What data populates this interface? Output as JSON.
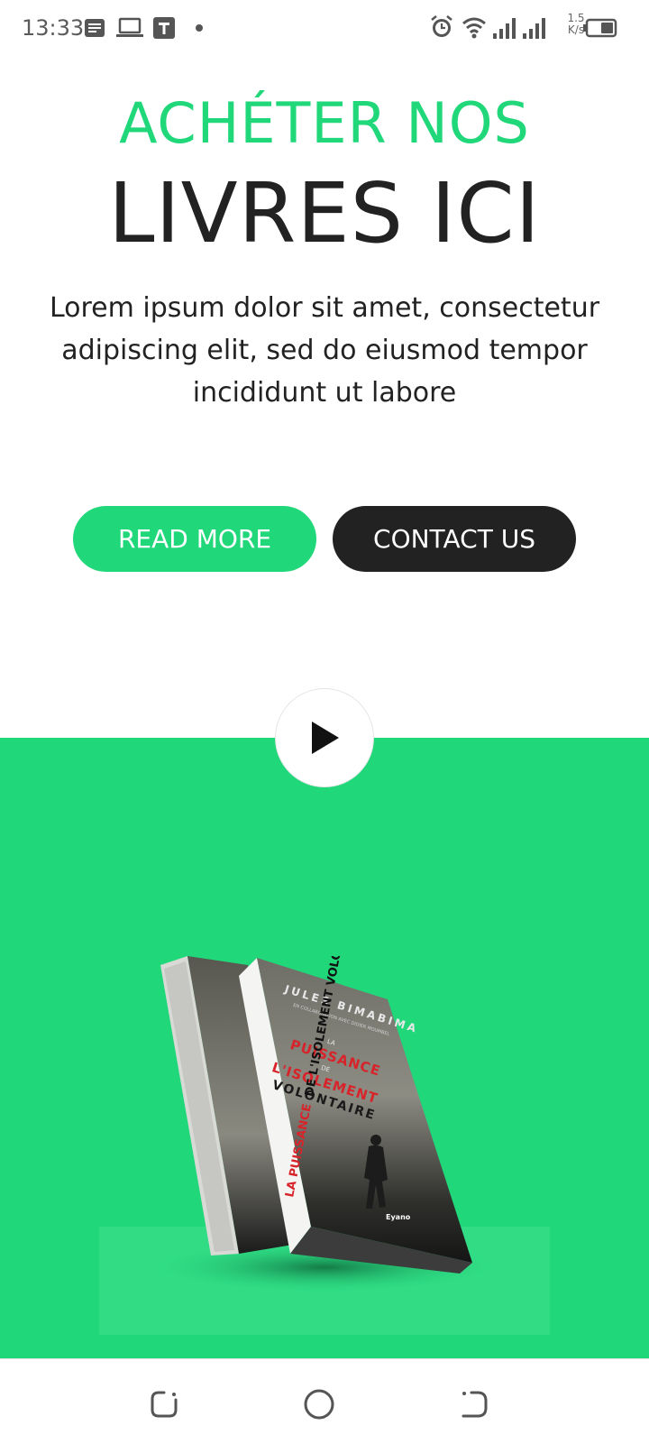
{
  "status_bar": {
    "time": "13:33",
    "speed_top": "1.5",
    "speed_bottom": "K/s",
    "left_icons": [
      "notes-icon",
      "laptop-icon",
      "t-app-icon",
      "dot-icon"
    ],
    "right_icons": [
      "alarm-icon",
      "wifi-icon",
      "signal-icon",
      "signal-icon",
      "battery-icon"
    ]
  },
  "hero": {
    "title_line1": "ACHÉTER NOS",
    "title_line2": "LIVRES ICI",
    "description": "Lorem ipsum dolor sit amet, consectetur adipiscing elit, sed do eiusmod tempor incididunt ut labore"
  },
  "buttons": {
    "read_more": "READ MORE",
    "contact_us": "CONTACT US"
  },
  "book": {
    "author": "JULES BIMABIMA",
    "collab": "EN COLLABORATION AVEC DIDIER MOUMBEL",
    "title_la": "LA",
    "title_puissance": "PUISSANCE",
    "title_de": "DE",
    "title_isolement": "L'ISOLEMENT",
    "title_volontaire": "VOLONTAIRE",
    "spine_red": "LA PUISSANCE",
    "spine_black": "DE L'ISOLEMENT VOLONTAIRE",
    "publisher": "Eyano"
  },
  "colors": {
    "accent": "#20d77a",
    "dark": "#222222",
    "book_red": "#d8232a"
  },
  "nav": {
    "icons": [
      "recent-apps-icon",
      "home-icon",
      "back-icon"
    ]
  }
}
